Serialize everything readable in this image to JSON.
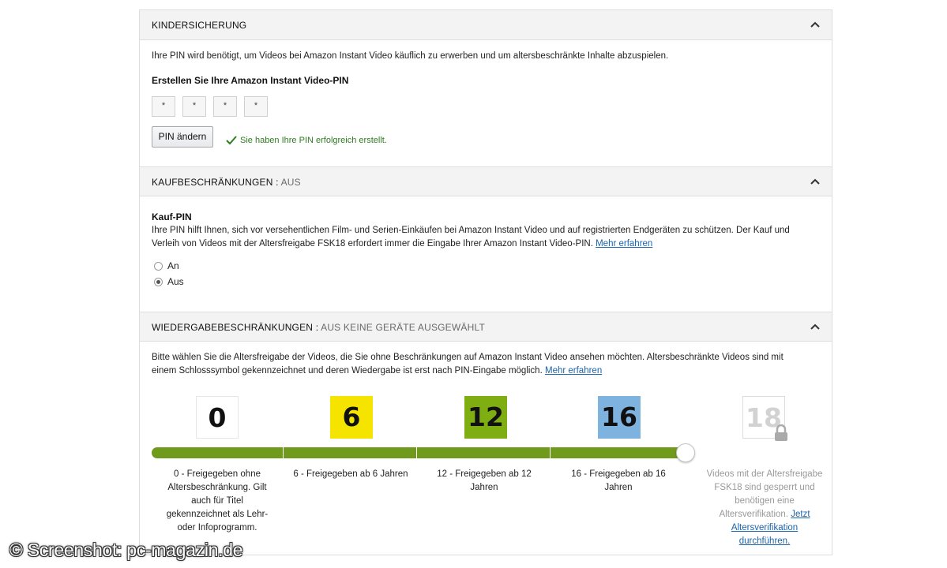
{
  "child_lock": {
    "title": "KINDERSICHERUNG",
    "description": "Ihre PIN wird benötigt, um Videos bei Amazon Instant Video käuflich zu erwerben und um altersbeschränkte Inhalte abzuspielen.",
    "pin_heading": "Erstellen Sie Ihre Amazon Instant Video-PIN",
    "pin_digits": [
      "*",
      "*",
      "*",
      "*"
    ],
    "change_pin_label": "PIN ändern",
    "success_message": "Sie haben Ihre PIN erfolgreich erstellt."
  },
  "purchase": {
    "title": "KAUFBESCHRÄNKUNGEN :",
    "status": "AUS",
    "subheading": "Kauf-PIN",
    "description_line1": "Ihre PIN hilft Ihnen, sich vor versehentlichen Film- und Serien-Einkäufen bei Amazon Instant Video und auf registrierten Endgeräten zu schützen. Der Kauf und",
    "description_line2": "Verleih von Videos mit der Altersfreigabe FSK18 erfordert immer die Eingabe Ihrer Amazon Instant Video-PIN.",
    "more_link": "Mehr erfahren",
    "options": [
      "An",
      "Aus"
    ],
    "selected": "Aus"
  },
  "playback": {
    "title": "WIEDERGABEBESCHRÄNKUNGEN :",
    "status": "AUS KEINE GERÄTE AUSGEWÄHLT",
    "description_line1": "Bitte wählen Sie die Altersfreigabe der Videos, die Sie ohne Beschränkungen auf Amazon Instant Video ansehen möchten. Altersbeschränkte Videos sind mit",
    "description_line2": "einem Schlosssymbol gekennzeichnet und deren Wiedergabe ist erst nach PIN-Eingabe möglich.",
    "more_link": "Mehr erfahren",
    "slider_value": "16",
    "levels": [
      {
        "rating": "0",
        "color": "#ffffff",
        "text": "0 - Freigegeben ohne Altersbeschränkung. Gilt auch für Titel gekennzeichnet als Lehr- oder Infoprogramm."
      },
      {
        "rating": "6",
        "color": "#f5e400",
        "text": "6 - Freigegeben ab 6 Jahren"
      },
      {
        "rating": "12",
        "color": "#7fae12",
        "text": "12 - Freigegeben ab 12 Jahren"
      },
      {
        "rating": "16",
        "color": "#7eb3df",
        "text": "16 - Freigegeben ab 16 Jahren"
      },
      {
        "rating": "18",
        "color": "#ffffff",
        "text": "Videos mit der Altersfreigabe FSK18 sind gesperrt und benötigen eine Altersverifikation.",
        "link": "Jetzt Altersverifikation durchführen."
      }
    ]
  },
  "colors": {
    "slider_track": "#6f9a1b",
    "link": "#1d64a8",
    "success": "#2e7d1e"
  },
  "watermark": "© Screenshot: pc-magazin.de"
}
